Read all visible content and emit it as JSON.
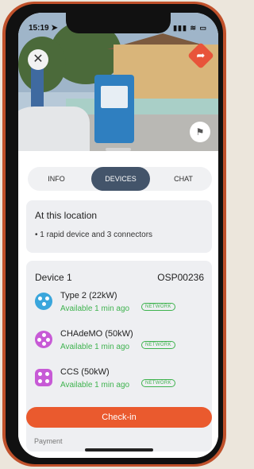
{
  "status_bar": {
    "time": "15:19 ➤",
    "icons": "▮▮▮ ≋ ▭"
  },
  "photo": {
    "close_glyph": "✕",
    "navigate_glyph": "➦",
    "bookmark_glyph": "⚑"
  },
  "tabs": [
    {
      "label": "INFO",
      "active": false
    },
    {
      "label": "DEVICES",
      "active": true
    },
    {
      "label": "CHAT",
      "active": false
    }
  ],
  "location": {
    "title": "At this location",
    "summary": "• 1 rapid device and 3 connectors"
  },
  "device": {
    "title": "Device 1",
    "code": "OSP00236",
    "connectors": [
      {
        "name": "Type 2 (22kW)",
        "status": "Available 1 min ago",
        "badge": "NETWORK",
        "icon": "type2-plug-icon",
        "color": "#3aa6dc"
      },
      {
        "name": "CHAdeMO (50kW)",
        "status": "Available 1 min ago",
        "badge": "NETWORK",
        "icon": "chademo-plug-icon",
        "color": "#c75ad6"
      },
      {
        "name": "CCS (50kW)",
        "status": "Available 1 min ago",
        "badge": "NETWORK",
        "icon": "ccs-plug-icon",
        "color": "#c75ad6"
      }
    ]
  },
  "checkin_label": "Check-in",
  "payment_label": "Payment",
  "colors": {
    "accent": "#ea5a2e",
    "tab_active": "#43546a",
    "available": "#3fb34f"
  }
}
